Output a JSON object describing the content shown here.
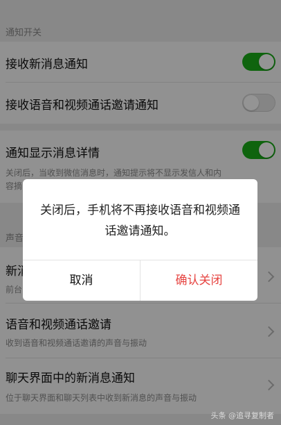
{
  "notifications": {
    "section_label": "通知开关",
    "receive_new_messages": {
      "title": "接收新消息通知",
      "enabled": true
    },
    "receive_call_invites": {
      "title": "接收语音和视频通话邀请通知",
      "enabled": false
    },
    "show_details": {
      "title": "通知显示消息详情",
      "enabled": true,
      "description_line1": "关闭后，当收到微信消息时，通知提示将不显示发信人和内",
      "description_line2": "容摘"
    }
  },
  "sound_section": {
    "section_label": "声音",
    "new_message": {
      "title": "新消",
      "subtitle": "前台"
    },
    "call_invite": {
      "title": "语音和视频通话邀请",
      "subtitle": "收到语音和视频通话邀请的声音与振动"
    },
    "chat_new_message": {
      "title": "聊天界面中的新消息通知",
      "subtitle": "位于聊天界面和聊天列表中收到新消息的声音与振动"
    }
  },
  "dialog": {
    "message": "关闭后，手机将不再接收语音和视频通话邀请通知。",
    "cancel_label": "取消",
    "confirm_label": "确认关闭"
  },
  "watermark": "头条 @追寻复制者",
  "colors": {
    "toggle_on": "#1aad19",
    "confirm_text": "#e64340",
    "cancel_text": "#111111"
  }
}
